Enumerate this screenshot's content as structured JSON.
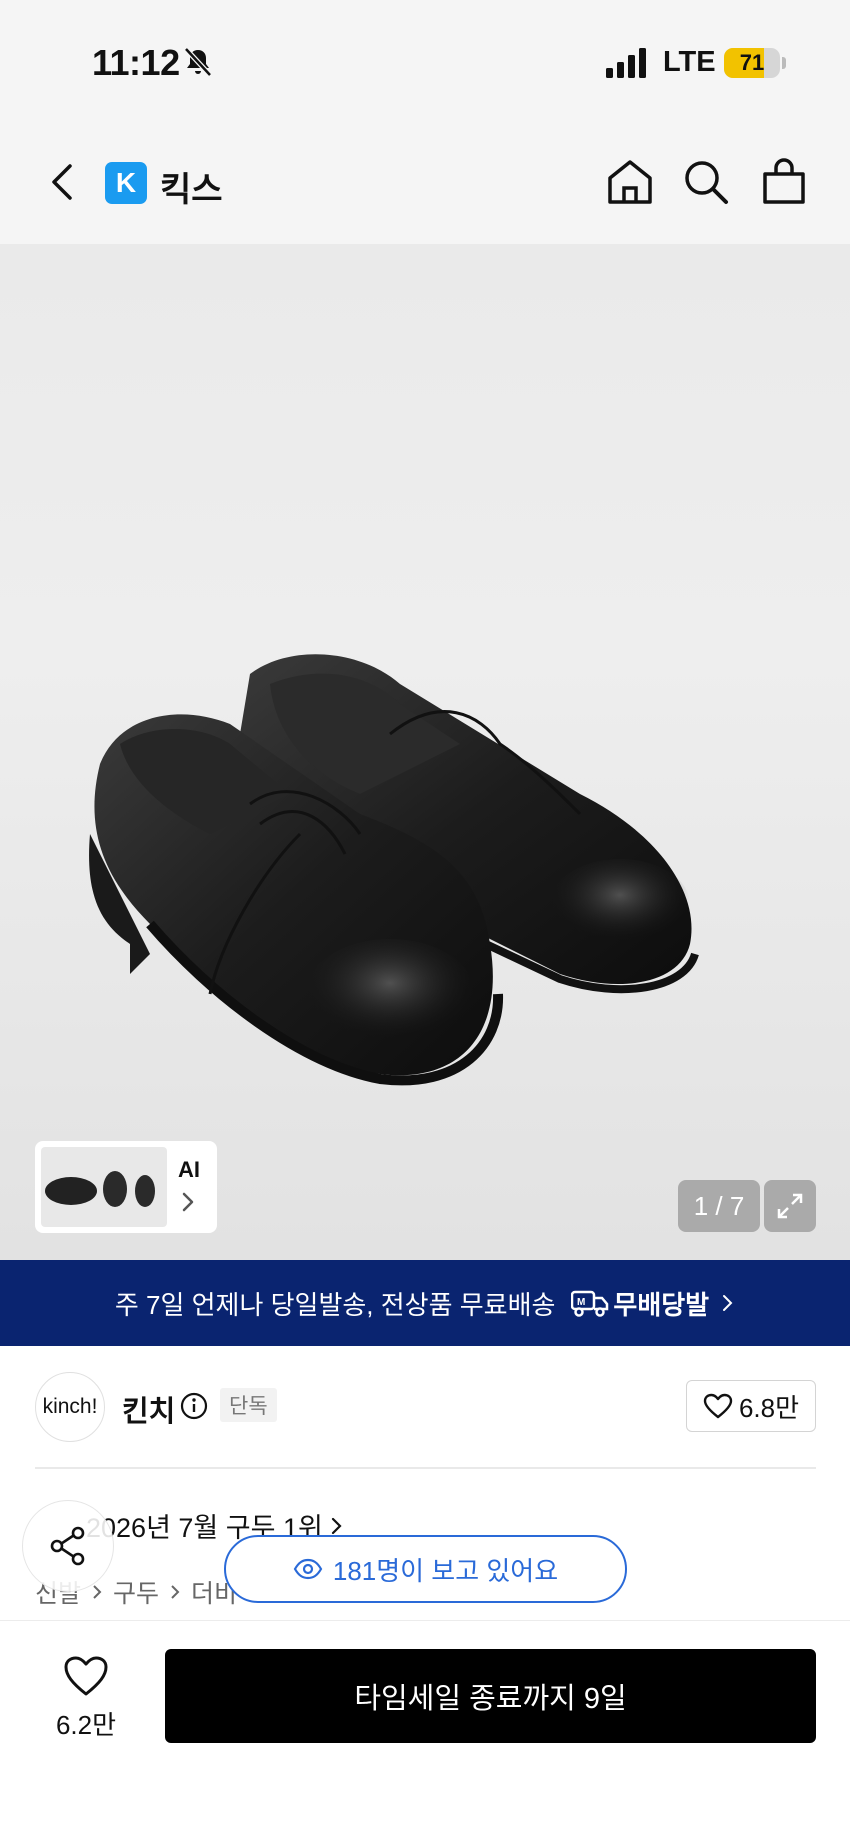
{
  "status_bar": {
    "time": "11:12",
    "network": "LTE",
    "battery_percent": 71,
    "battery_label": "71",
    "icons": [
      "bell-slash-icon",
      "signal-icon"
    ]
  },
  "header": {
    "logo_letter": "K",
    "brand_name": "킥스",
    "icons": [
      "back-icon",
      "home-icon",
      "search-icon",
      "cart-icon"
    ]
  },
  "gallery": {
    "thumbnail_label": "AI",
    "page_counter": "1 / 7",
    "icons": [
      "chevron-right-icon",
      "expand-icon"
    ]
  },
  "promo_banner": {
    "text": "주 7일 언제나 당일발송, 전상품 무료배송",
    "service_name": "무배당발",
    "colors": {
      "background": "#0a2470",
      "text": "#ffffff"
    }
  },
  "brand": {
    "avatar_text": "kinch!",
    "name": "킨치",
    "badge": "단독",
    "like_count": "6.8만"
  },
  "ranking": {
    "text": "2026년 7월 구두 1위"
  },
  "breadcrumb": [
    "신발",
    "구두",
    "더비"
  ],
  "viewers": {
    "text": "181명이 보고 있어요",
    "color": "#2a6ad8"
  },
  "bottom_bar": {
    "wish_count": "6.2만",
    "cta_label": "타임세일 종료까지 9일"
  }
}
